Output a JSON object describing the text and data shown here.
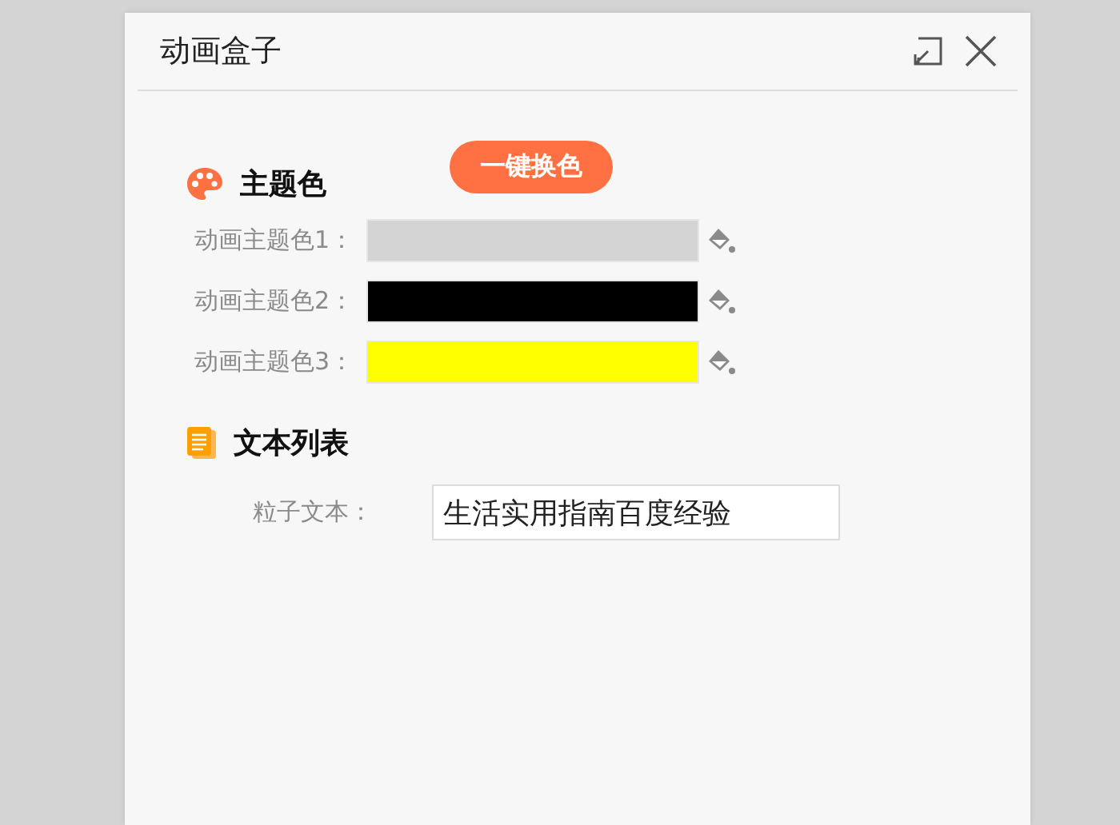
{
  "window": {
    "title": "动画盒子"
  },
  "theme_section": {
    "title": "主题色",
    "button": "一键换色",
    "colors": [
      {
        "label": "动画主题色1：",
        "color": "#d4d4d4"
      },
      {
        "label": "动画主题色2：",
        "color": "#000000"
      },
      {
        "label": "动画主题色3：",
        "color": "#ffff00"
      }
    ]
  },
  "text_section": {
    "title": "文本列表",
    "field": {
      "label": "粒子文本：",
      "value": "生活实用指南百度经验"
    }
  }
}
